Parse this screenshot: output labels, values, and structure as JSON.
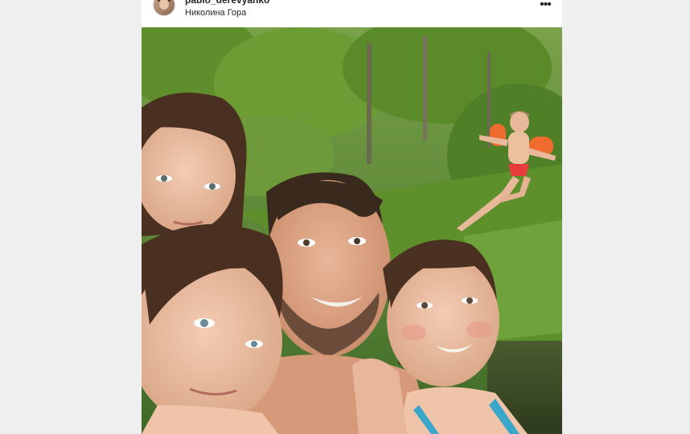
{
  "post": {
    "username": "pablo_derevyanko",
    "location": "Николина Гора",
    "more_icon": "ellipsis-horizontal-icon",
    "more_glyph": "•••"
  },
  "photo": {
    "description_icon": "photo"
  },
  "colors": {
    "background": "#efefef",
    "card": "#ffffff",
    "text": "#262626"
  }
}
